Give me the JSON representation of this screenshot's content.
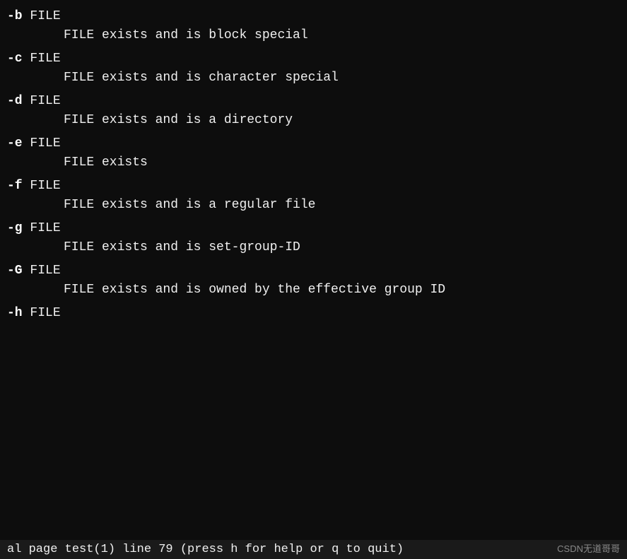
{
  "terminal": {
    "entries": [
      {
        "flag": "-b",
        "arg": " FILE",
        "description": "      FILE exists and is block special"
      },
      {
        "flag": "-c",
        "arg": " FILE",
        "description": "      FILE exists and is character special"
      },
      {
        "flag": "-d",
        "arg": " FILE",
        "description": "      FILE exists and is a directory"
      },
      {
        "flag": "-e",
        "arg": " FILE",
        "description": "      FILE exists"
      },
      {
        "flag": "-f",
        "arg": " FILE",
        "description": "      FILE exists and is a regular file"
      },
      {
        "flag": "-g",
        "arg": " FILE",
        "description": "      FILE exists and is set-group-ID"
      },
      {
        "flag": "-G",
        "arg": " FILE",
        "description": "      FILE exists and is owned by the effective group ID"
      },
      {
        "flag": "-h",
        "arg": " FILE",
        "description": ""
      }
    ],
    "status_bar": "al page test(1) line 79 (press h for help or q to quit)"
  },
  "watermark": "CSDN无道哥哥"
}
